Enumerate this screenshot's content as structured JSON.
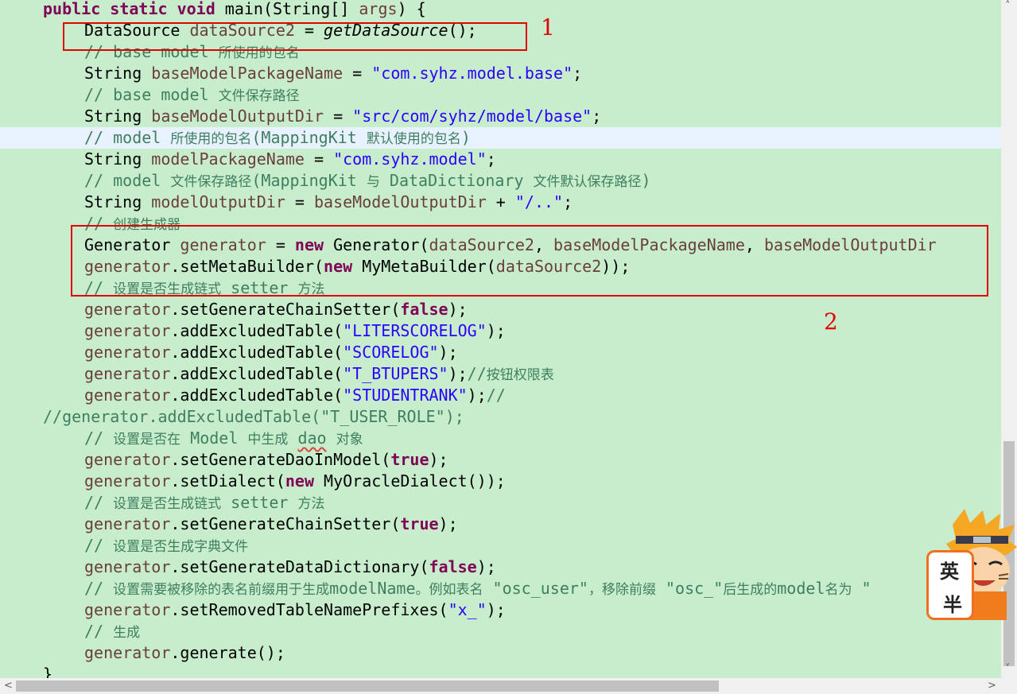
{
  "code": {
    "lines": [
      "public static void main(String[] args) {",
      "DataSource dataSource2 = getDataSource();",
      "// base model 所使用的包名",
      "String baseModelPackageName = \"com.syhz.model.base\";",
      "// base model 文件保存路径",
      "String baseModelOutputDir = \"src/com/syhz/model/base\";",
      "// model 所使用的包名(MappingKit 默认使用的包名)",
      "String modelPackageName = \"com.syhz.model\";",
      "// model 文件保存路径(MappingKit 与 DataDictionary 文件默认保存路径)",
      "String modelOutputDir = baseModelOutputDir + \"/..\";",
      "// 创建生成器",
      "Generator generator = new Generator(dataSource2, baseModelPackageName, baseModelOutputDir",
      "generator.setMetaBuilder(new MyMetaBuilder(dataSource2));",
      "// 设置是否生成链式 setter 方法",
      "generator.setGenerateChainSetter(false);",
      "generator.addExcludedTable(\"LITERSCORELOG\");",
      "generator.addExcludedTable(\"SCORELOG\");",
      "generator.addExcludedTable(\"T_BTUPERS\");//按钮权限表",
      "generator.addExcludedTable(\"STUDENTRANK\");//",
      "//generator.addExcludedTable(\"T_USER_ROLE\");",
      "// 设置是否在 Model 中生成 dao 对象",
      "generator.setGenerateDaoInModel(true);",
      "generator.setDialect(new MyOracleDialect());",
      "// 设置是否生成链式 setter 方法",
      "generator.setGenerateChainSetter(true);",
      "// 设置是否生成字典文件",
      "generator.setGenerateDataDictionary(false);",
      "// 设置需要被移除的表名前缀用于生成modelName。例如表名 \"osc_user\"，移除前缀 \"osc_\"后生成的model名为 \"",
      "generator.setRemovedTableNamePrefixes(\"x_\");",
      "// 生成",
      "generator.generate();",
      "}"
    ]
  },
  "annotations": {
    "label1": "1",
    "label2": "2",
    "box_color": "#e00000"
  },
  "ime_widget": {
    "top": "英",
    "bottom": "半"
  },
  "scrollbars": {
    "up_arrow": "˄",
    "down_arrow": "˅",
    "left_arrow": "<",
    "right_arrow": ">"
  },
  "colors": {
    "background": "#c7edcc",
    "highlight_line": "#e8f2fe",
    "keyword": "#7f0055",
    "variable": "#6a3e3e",
    "string": "#2a00ff",
    "comment": "#3f7f5f"
  }
}
